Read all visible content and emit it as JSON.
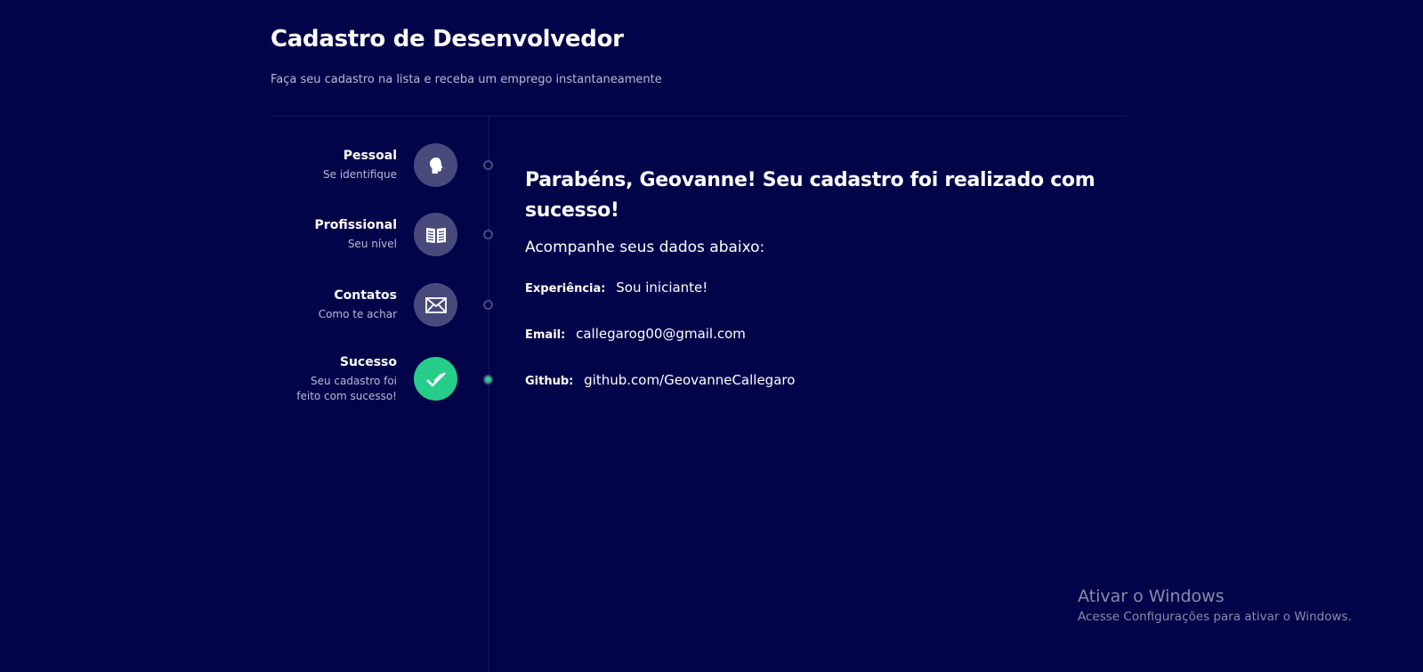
{
  "header": {
    "title": "Cadastro de Desenvolvedor",
    "subtitle": "Faça seu cadastro na lista e receba um emprego instantaneamente"
  },
  "steps": [
    {
      "title": "Pessoal",
      "description": "Se identifique",
      "icon": "head-icon",
      "active": false
    },
    {
      "title": "Profissional",
      "description": "Seu nível",
      "icon": "book-icon",
      "active": false
    },
    {
      "title": "Contatos",
      "description": "Como te achar",
      "icon": "mail-icon",
      "active": false
    },
    {
      "title": "Sucesso",
      "description": "Seu cadastro foi feito com sucesso!",
      "icon": "check-icon",
      "active": true
    }
  ],
  "result": {
    "title": "Parabéns, Geovanne! Seu cadastro foi realizado com sucesso!",
    "subtitle": "Acompanhe seus dados abaixo:",
    "fields": [
      {
        "label": "Experiência:",
        "value": "Sou iniciante!"
      },
      {
        "label": "Email:",
        "value": "callegarog00@gmail.com"
      },
      {
        "label": "Github:",
        "value": "github.com/GeovanneCallegaro"
      }
    ]
  },
  "watermark": {
    "title": "Ativar o Windows",
    "subtitle": "Acesse Configurações para ativar o Windows."
  },
  "colors": {
    "background": "#02044a",
    "icon_inactive": "#494a7c",
    "accent_success": "#25cd89",
    "muted_text": "#b8b9d4"
  }
}
